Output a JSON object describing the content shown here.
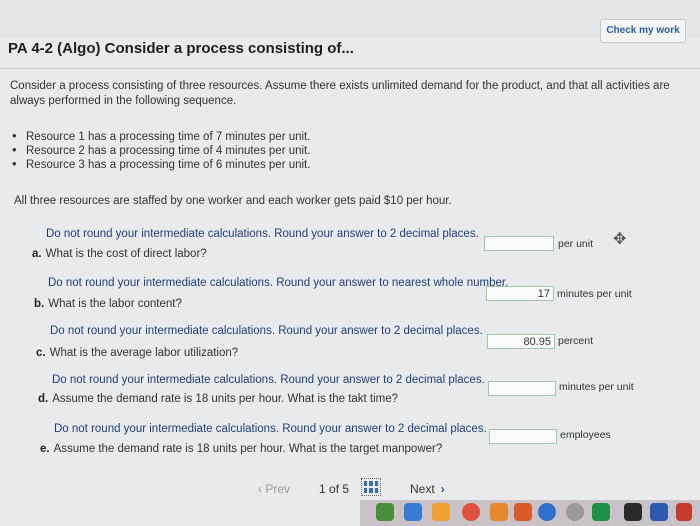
{
  "header": {
    "check_label": "Check my work"
  },
  "title": "PA 4-2 (Algo) Consider a process consisting of...",
  "intro": "Consider a process consisting of three resources. Assume there exists unlimited demand for the product, and that all activities are always performed in the following sequence.",
  "bullets": [
    "Resource 1 has a processing time of 7 minutes per unit.",
    "Resource 2 has a processing time of 4 minutes per unit.",
    "Resource 3 has a processing time of 6 minutes per unit."
  ],
  "staffing": "All three resources are staffed by one worker and each worker gets paid $10 per hour.",
  "questions": [
    {
      "instr": "Do not round your intermediate calculations. Round your answer to 2 decimal places.",
      "letter": "a.",
      "text": "What is the cost of direct labor?",
      "value": "",
      "unit": "per unit"
    },
    {
      "instr": "Do not round your intermediate calculations. Round your answer to nearest whole number.",
      "letter": "b.",
      "text": "What is the labor content?",
      "value": "17",
      "unit": "minutes per unit"
    },
    {
      "instr": "Do not round your intermediate calculations. Round your answer to 2 decimal places.",
      "letter": "c.",
      "text": "What is the average labor utilization?",
      "value": "80.95",
      "unit": "percent"
    },
    {
      "instr": "Do not round your intermediate calculations. Round your answer to 2 decimal places.",
      "letter": "d.",
      "text": "Assume the demand rate is 18 units per hour. What is the takt time?",
      "value": "",
      "unit": "minutes per unit"
    },
    {
      "instr": "Do not round your intermediate calculations. Round your answer to 2 decimal places.",
      "letter": "e.",
      "text": "Assume the demand rate is 18 units per hour. What is the target manpower?",
      "value": "",
      "unit": "employees"
    }
  ],
  "nav": {
    "prev": "Prev",
    "page": "1",
    "of": "of",
    "total": "5",
    "next": "Next"
  },
  "colors": {
    "instr": "#1f3f7a",
    "accent": "#2b5c9c",
    "field_border": "#9fcaa8"
  }
}
